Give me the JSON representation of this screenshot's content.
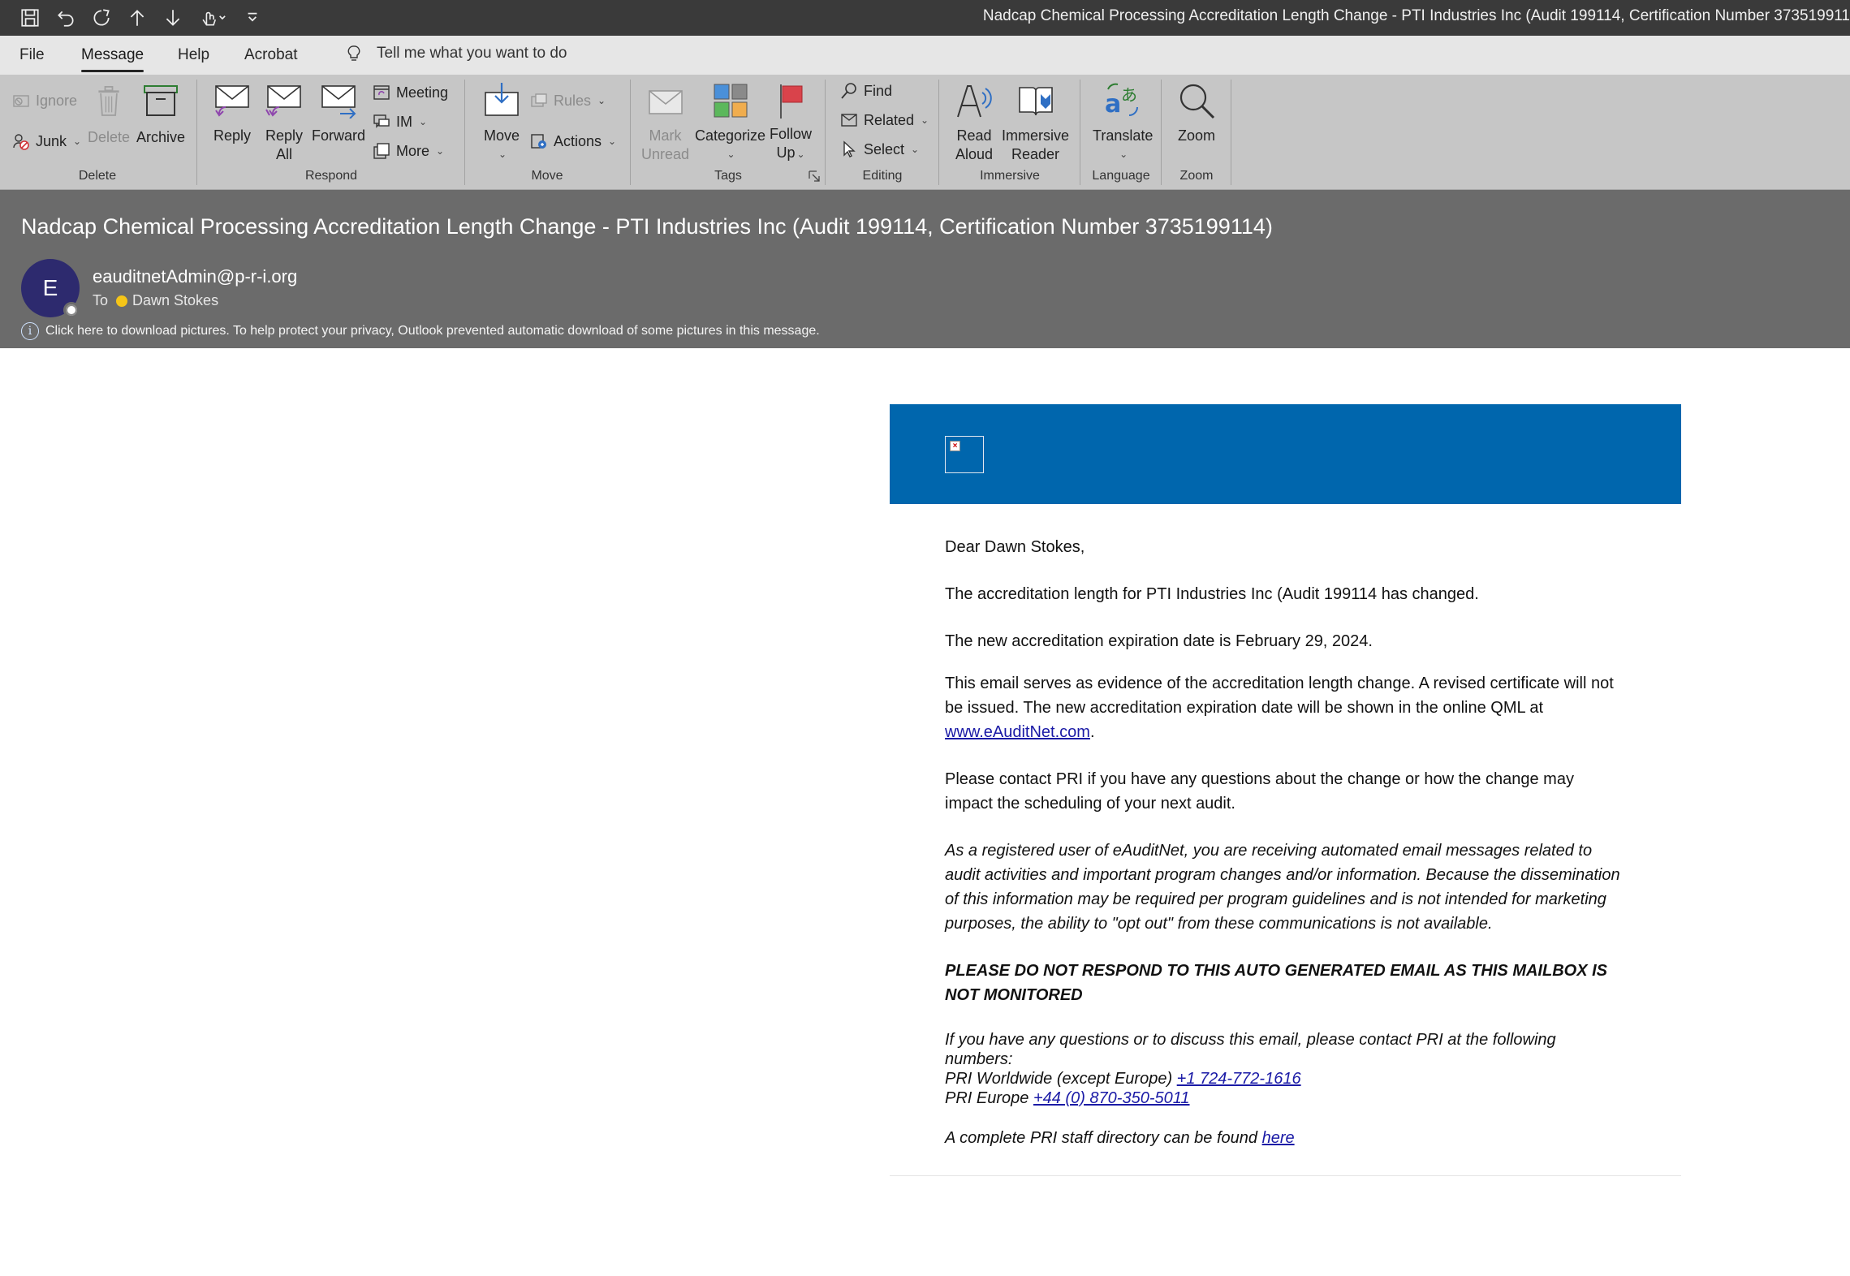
{
  "window": {
    "title": "Nadcap Chemical Processing Accreditation Length Change - PTI Industries Inc (Audit 199114, Certification Number 373519911"
  },
  "quick_access": [
    "save-icon",
    "undo-icon",
    "redo-icon",
    "up-arrow-icon",
    "down-arrow-icon",
    "touch-mode-icon",
    "customize-icon"
  ],
  "menu": {
    "file": "File",
    "message": "Message",
    "help": "Help",
    "acrobat": "Acrobat",
    "tell_me": "Tell me what you want to do"
  },
  "ribbon": {
    "delete_group": {
      "label": "Delete",
      "ignore": "Ignore",
      "junk": "Junk",
      "delete": "Delete",
      "archive": "Archive"
    },
    "respond_group": {
      "label": "Respond",
      "reply": "Reply",
      "reply_all_1": "Reply",
      "reply_all_2": "All",
      "forward": "Forward",
      "meeting": "Meeting",
      "im": "IM",
      "more": "More"
    },
    "move_group": {
      "label": "Move",
      "move": "Move",
      "rules": "Rules",
      "actions": "Actions"
    },
    "tags_group": {
      "label": "Tags",
      "mark_unread_1": "Mark",
      "mark_unread_2": "Unread",
      "categorize": "Categorize",
      "follow_up_1": "Follow",
      "follow_up_2": "Up"
    },
    "editing_group": {
      "label": "Editing",
      "find": "Find",
      "related": "Related",
      "select": "Select"
    },
    "immersive_group": {
      "label": "Immersive",
      "read_aloud_1": "Read",
      "read_aloud_2": "Aloud",
      "immersive_reader_1": "Immersive",
      "immersive_reader_2": "Reader"
    },
    "language_group": {
      "label": "Language",
      "translate": "Translate"
    },
    "zoom_group": {
      "label": "Zoom",
      "zoom": "Zoom"
    }
  },
  "message": {
    "subject": "Nadcap Chemical Processing Accreditation Length Change - PTI Industries Inc (Audit 199114, Certification Number 3735199114)",
    "avatar_initial": "E",
    "sender": "eauditnetAdmin@p-r-i.org",
    "to_label": "To",
    "recipient": "Dawn Stokes",
    "info_bar": "Click here to download pictures. To help protect your privacy, Outlook prevented automatic download of some pictures in this message."
  },
  "body": {
    "greeting": "Dear Dawn Stokes,",
    "p1": "The accreditation length for PTI Industries Inc (Audit 199114 has changed.",
    "p2": "The new accreditation expiration date is February 29, 2024.",
    "p3_text": "This email serves as evidence of the accreditation length change. A revised certificate will not be issued. The new accreditation expiration date will be shown in the online QML at ",
    "p3_link": "www.eAuditNet.com",
    "p3_end": ".",
    "p4": "Please contact PRI if you have any questions about the change or how the change may impact the scheduling of your next audit.",
    "p5": "As a registered user of eAuditNet, you are receiving automated email messages related to audit activities and important program changes and/or information. Because the dissemination of this information may be required per program guidelines and is not intended for marketing purposes, the ability to \"opt out\" from these communications is not available.",
    "p6": "PLEASE DO NOT RESPOND TO THIS AUTO GENERATED EMAIL AS THIS MAILBOX IS NOT MONITORED",
    "p7_line1": "If you have any questions or to discuss this email, please contact PRI at the following numbers:",
    "p7_ww_label": "PRI Worldwide (except Europe) ",
    "p7_ww_phone": "+1 724-772-1616",
    "p7_eu_label": "PRI Europe ",
    "p7_eu_phone": "+44 (0) 870-350-5011",
    "p8_text": "A complete PRI staff directory can be found ",
    "p8_link": "here"
  },
  "colors": {
    "banner": "#0066ad",
    "avatar": "#2d2a6e",
    "link": "#1a1aa6",
    "header_bg": "#6b6b6b",
    "ribbon_bg": "#c6c6c6"
  }
}
